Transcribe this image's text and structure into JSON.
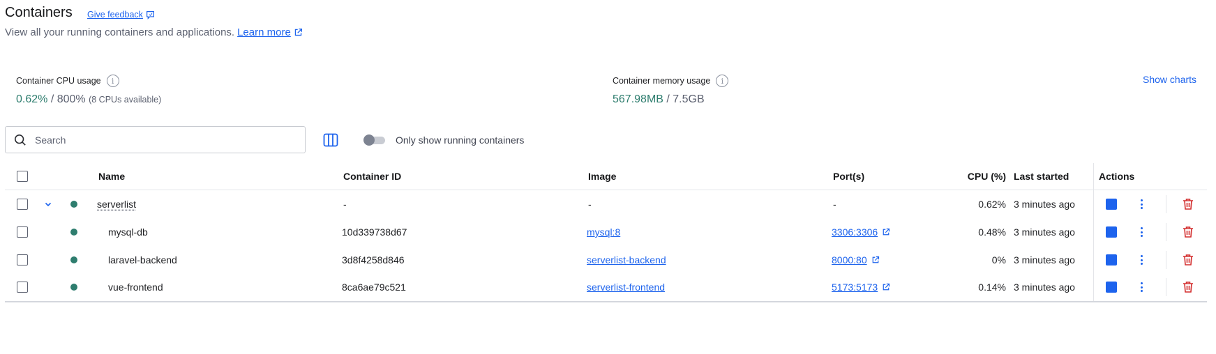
{
  "header": {
    "title": "Containers",
    "feedback_label": "Give feedback",
    "subtitle": "View all your running containers and applications.",
    "learn_more_label": "Learn more"
  },
  "stats": {
    "cpu": {
      "label": "Container CPU usage",
      "value": "0.62%",
      "separator": " / ",
      "total": "800%",
      "note": "(8 CPUs available)"
    },
    "memory": {
      "label": "Container memory usage",
      "value": "567.98MB",
      "separator": " / ",
      "total": "7.5GB"
    },
    "show_charts_label": "Show charts"
  },
  "toolbar": {
    "search_placeholder": "Search",
    "toggle_label": "Only show running containers",
    "toggle_on": false
  },
  "table": {
    "columns": {
      "name": "Name",
      "container_id": "Container ID",
      "image": "Image",
      "ports": "Port(s)",
      "cpu": "CPU (%)",
      "last_started": "Last started",
      "actions": "Actions"
    },
    "rows": [
      {
        "name": "serverlist",
        "container_id": "-",
        "image": "-",
        "ports": "-",
        "cpu": "0.62%",
        "last_started": "3 minutes ago",
        "group": true
      },
      {
        "name": "mysql-db",
        "container_id": "10d339738d67",
        "image": "mysql:8",
        "ports": "3306:3306",
        "cpu": "0.48%",
        "last_started": "3 minutes ago",
        "group": false
      },
      {
        "name": "laravel-backend",
        "container_id": "3d8f4258d846",
        "image": "serverlist-backend",
        "ports": "8000:80",
        "cpu": "0%",
        "last_started": "3 minutes ago",
        "group": false
      },
      {
        "name": "vue-frontend",
        "container_id": "8ca6ae79c521",
        "image": "serverlist-frontend",
        "ports": "5173:5173",
        "cpu": "0.14%",
        "last_started": "3 minutes ago",
        "group": false
      }
    ]
  },
  "colors": {
    "accent": "#1d63ed",
    "running_green": "#2e7d6e",
    "delete_red": "#d32f2f"
  }
}
